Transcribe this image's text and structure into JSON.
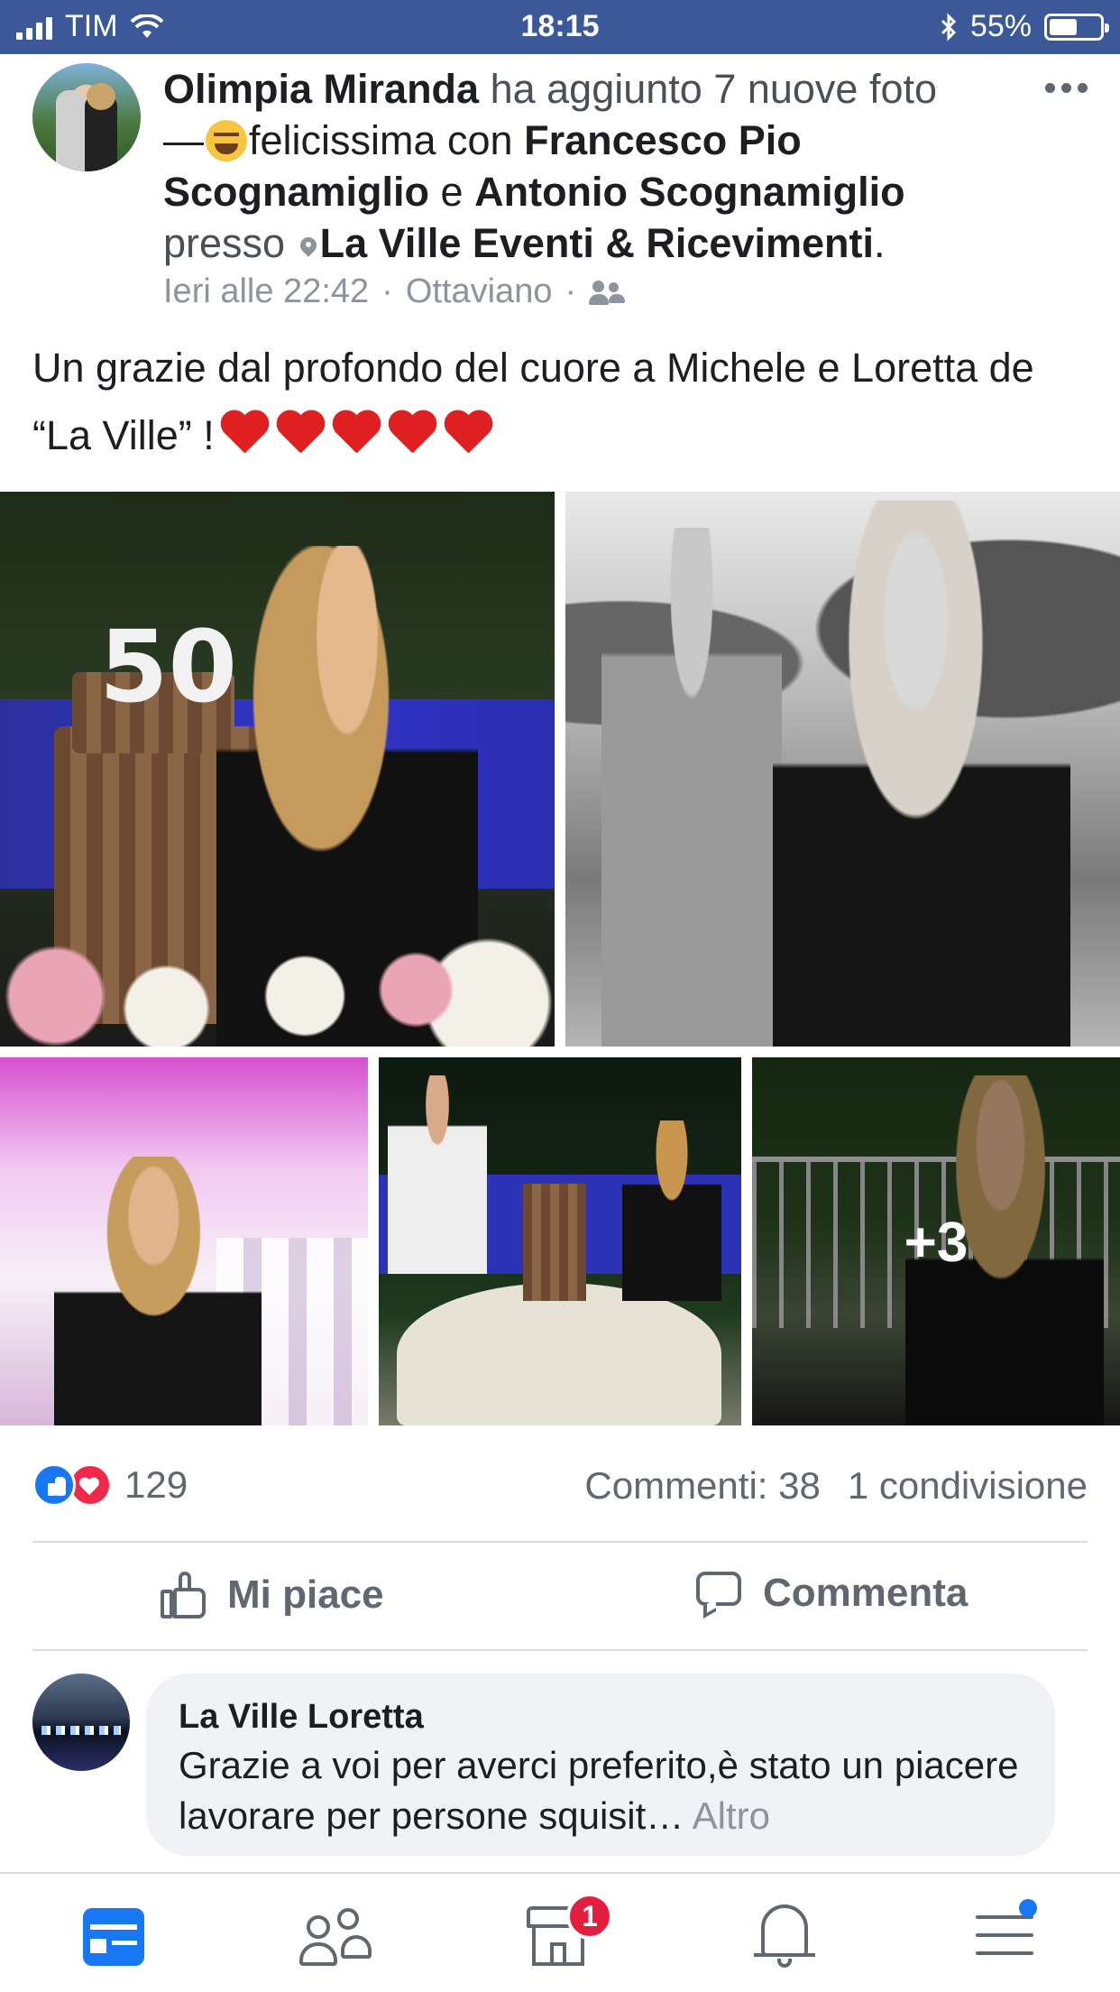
{
  "status_bar": {
    "carrier": "TIM",
    "time": "18:15",
    "battery": "55%",
    "battery_level": 0.55
  },
  "post": {
    "author": "Olimpia Miranda",
    "action_text": "ha aggiunto 7 nuove foto",
    "dash": "—",
    "feeling_text": "felicissima con",
    "tagged_1": "Francesco Pio Scognamiglio",
    "conj": "e",
    "tagged_2": "Antonio Scognamiglio",
    "at_text": "presso",
    "place": "La Ville Eventi & Ricevimenti",
    "period": ".",
    "time": "Ieri alle 22:42",
    "location": "Ottaviano",
    "sep": "·",
    "message": "Un grazie dal profondo del cuore a Michele e Loretta de “La Ville” !",
    "heart_count": 5,
    "extra_photos": "+3"
  },
  "reactions": {
    "count": "129",
    "comments": "Commenti: 38",
    "shares": "1 condivisione"
  },
  "actions": {
    "like": "Mi piace",
    "comment": "Commenta"
  },
  "comment": {
    "name": "La Ville Loretta",
    "text": "Grazie a voi per averci preferito,è stato un piacere lavorare per persone squisit…",
    "more": "Altro"
  },
  "tabbar": {
    "marketplace_badge": "1",
    "items": [
      "news-feed",
      "friends",
      "marketplace",
      "notifications",
      "menu"
    ]
  },
  "colors": {
    "brand": "#3b5998",
    "accent": "#1877f2",
    "badge": "#e41e3f"
  }
}
